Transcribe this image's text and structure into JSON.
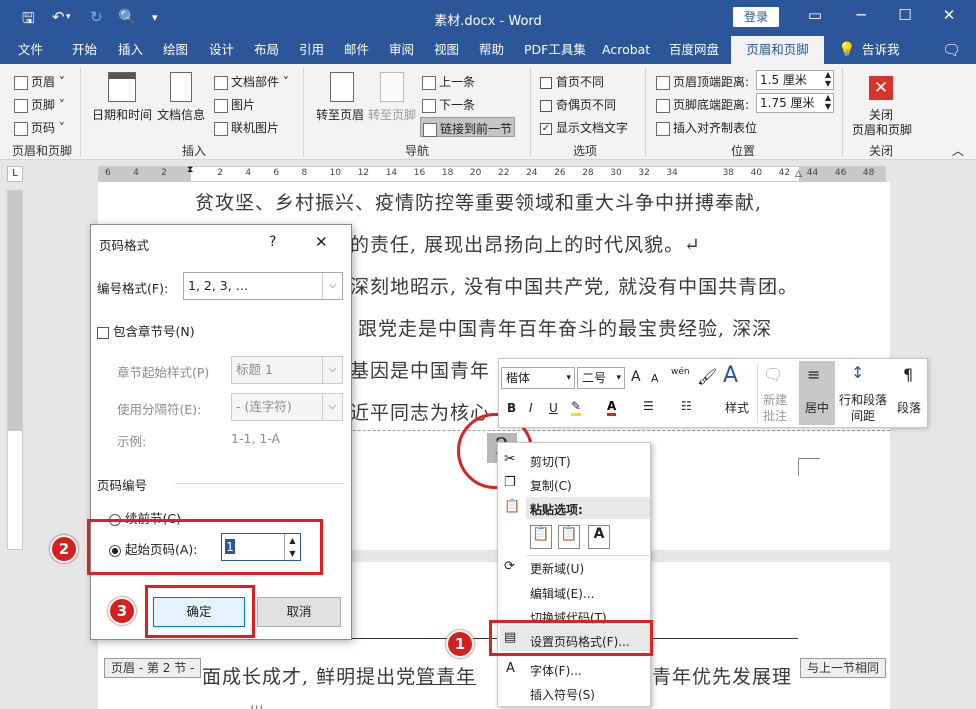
{
  "window": {
    "title": "素材.docx  -  Word",
    "login": "登录",
    "minimize": "─",
    "restore": "☐",
    "close": "✕"
  },
  "tabs": [
    "文件",
    "开始",
    "插入",
    "绘图",
    "设计",
    "布局",
    "引用",
    "邮件",
    "审阅",
    "视图",
    "帮助",
    "PDF工具集",
    "Acrobat",
    "百度网盘"
  ],
  "active_tab": "页眉和页脚",
  "tell_me": "告诉我",
  "ribbon": {
    "hf_group": {
      "header": "页眉",
      "footer": "页脚",
      "page_number": "页码",
      "label": "页眉和页脚"
    },
    "insert_group": {
      "datetime": "日期和时间",
      "docinfo": "文档信息",
      "quickparts": "文档部件",
      "pictures": "图片",
      "online_pictures": "联机图片",
      "label": "插入"
    },
    "nav_group": {
      "goto_header": "转至页眉",
      "goto_footer": "转至页脚",
      "prev": "上一条",
      "next": "下一条",
      "link_prev": "链接到前一节",
      "label": "导航"
    },
    "options_group": {
      "diff_first": "首页不同",
      "diff_odd_even": "奇偶页不同",
      "show_text": "显示文档文字",
      "label": "选项"
    },
    "position_group": {
      "header_top": "页眉顶端距离:",
      "header_top_val": "1.5 厘米",
      "footer_bottom": "页脚底端距离:",
      "footer_bottom_val": "1.75 厘米",
      "insert_align_tab": "插入对齐制表位",
      "label": "位置"
    },
    "close_group": {
      "close_line1": "关闭",
      "close_line2": "页眉和页脚",
      "label": "关闭"
    }
  },
  "ruler": {
    "ticks": [
      "6",
      "4",
      "2",
      "",
      "2",
      "4",
      "6",
      "8",
      "10",
      "12",
      "14",
      "16",
      "18",
      "20",
      "22",
      "24",
      "26",
      "28",
      "30",
      "32",
      "34",
      "",
      "38",
      "40",
      "42",
      "44",
      "46",
      "48"
    ],
    "corner": "L"
  },
  "document": {
    "line1": "贫攻坚、乡村振兴、疫情防控等重要领域和重大斗争中拼搏奉献,",
    "line2": "的责任, 展现出昂扬向上的时代风貌。↵",
    "line3": "深刻地昭示, 没有中国共产党, 就没有中国共青团。",
    "line4": "跟党走是中国青年百年奋斗的最宝贵经验, 深深",
    "line5": "基因是中国青年",
    "line6": "近平同志为核心",
    "page_num": "2",
    "page2_line1_a": "面成长成才, 鲜明提出党",
    "page2_line1_b": "管青年",
    "page2_line1_c": "青年优先发展理",
    "page2_line2": "一批"
  },
  "header_tags": {
    "left": "页眉 - 第 2 节 -",
    "right": "与上一节相同"
  },
  "dialog": {
    "title": "页码格式",
    "help": "?",
    "close": "✕",
    "number_format_label": "编号格式(F):",
    "number_format_value": "1, 2, 3, …",
    "include_chapter": "包含章节号(N)",
    "chapter_style_label": "章节起始样式(P)",
    "chapter_style_value": "标题 1",
    "separator_label": "使用分隔符(E):",
    "separator_value": "-  (连字符)",
    "example_label": "示例:",
    "example_value": "1-1, 1-A",
    "page_numbering": "页码编号",
    "continue_prev": "续前节(C)",
    "start_at": "起始页码(A):",
    "start_value": "1",
    "ok": "确定",
    "cancel": "取消"
  },
  "minibar": {
    "font": "楷体",
    "size": "二号",
    "grow": "A",
    "shrink": "A",
    "phonetic": "wén",
    "bold": "B",
    "italic": "I",
    "underline": "U",
    "styles": "样式",
    "new_comment_1": "新建",
    "new_comment_2": "批注",
    "center": "居中",
    "line_spacing_1": "行和段落",
    "line_spacing_2": "间距",
    "paragraph": "段落"
  },
  "context_menu": {
    "cut": "剪切(T)",
    "copy": "复制(C)",
    "paste_options": "粘贴选项:",
    "update_field": "更新域(U)",
    "edit_field": "编辑域(E)...",
    "toggle_codes": "切换域代码(T)",
    "format_page_numbers": "设置页码格式(F)...",
    "font": "字体(F)...",
    "insert_symbol": "插入符号(S)"
  },
  "badges": [
    "1",
    "2",
    "3"
  ],
  "colors": {
    "brand": "#2b579a",
    "annotation": "#e02020"
  }
}
